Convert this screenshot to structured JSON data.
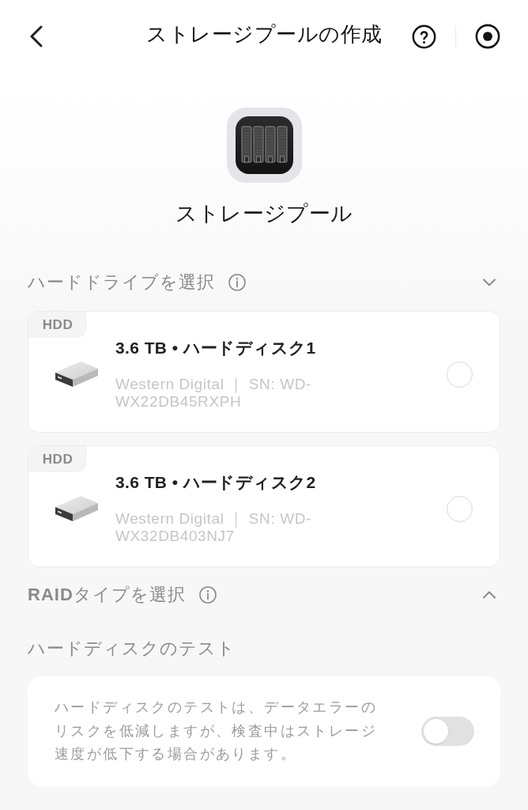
{
  "header": {
    "title": "ストレージプールの作成"
  },
  "pool": {
    "name": "ストレージプール"
  },
  "drive_section": {
    "title": "ハードドライブを選択",
    "expanded": true
  },
  "drives": [
    {
      "tag": "HDD",
      "title": "3.6 TB • ハードディスク1",
      "details": "Western Digital ｜ SN: WD-WX22DB45RXPH",
      "selected": false
    },
    {
      "tag": "HDD",
      "title": "3.6 TB • ハードディスク2",
      "details": "Western Digital ｜ SN: WD-WX32DB403NJ7",
      "selected": false
    }
  ],
  "raid_section": {
    "title": "**RAID**タイプを選択",
    "expanded": false
  },
  "disk_test": {
    "title": "ハードディスクのテスト",
    "description": "ハードディスクのテストは、データエラーのリスクを低減しますが、検査中はストレージ速度が低下する場合があります。",
    "on": false
  }
}
